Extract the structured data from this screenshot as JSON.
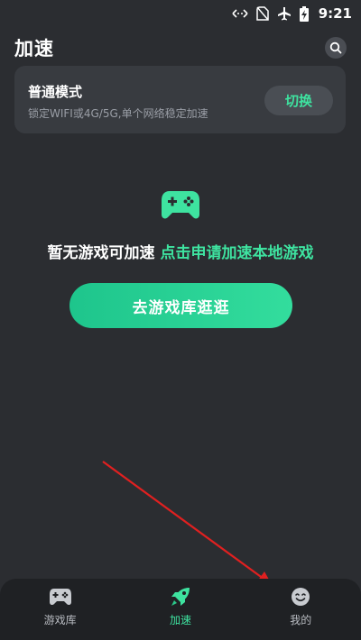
{
  "status_bar": {
    "time": "9:21"
  },
  "header": {
    "title": "加速",
    "search_icon": "search-icon"
  },
  "mode_card": {
    "title": "普通模式",
    "description": "锁定WIFI或4G/5G,单个网络稳定加速",
    "switch_label": "切换"
  },
  "empty_state": {
    "icon": "gamepad-icon",
    "message": "暂无游戏可加速",
    "link": "点击申请加速本地游戏",
    "button_label": "去游戏库逛逛"
  },
  "bottom_nav": {
    "items": [
      {
        "label": "游戏库",
        "icon": "gamepad-icon",
        "active": false
      },
      {
        "label": "加速",
        "icon": "rocket-icon",
        "active": true
      },
      {
        "label": "我的",
        "icon": "smiley-icon",
        "active": false
      }
    ]
  },
  "colors": {
    "accent": "#3ee3a0",
    "background": "#2b2d31",
    "card": "#383b40",
    "nav_background": "#1f2124",
    "annotation_arrow": "#e02020"
  }
}
